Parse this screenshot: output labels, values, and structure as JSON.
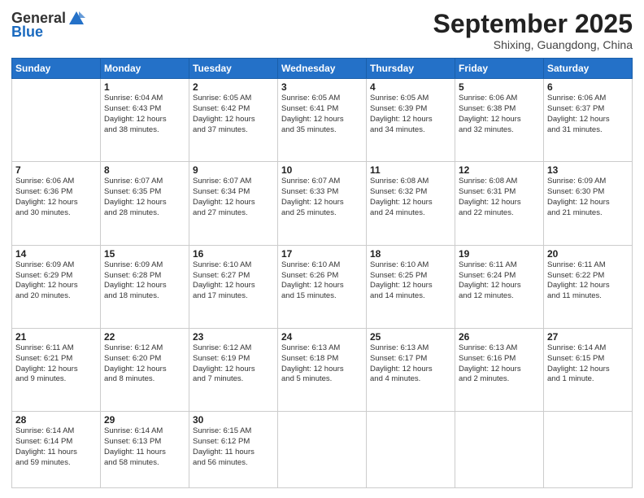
{
  "header": {
    "logo": {
      "general": "General",
      "blue": "Blue"
    },
    "title": "September 2025",
    "location": "Shixing, Guangdong, China"
  },
  "weekdays": [
    "Sunday",
    "Monday",
    "Tuesday",
    "Wednesday",
    "Thursday",
    "Friday",
    "Saturday"
  ],
  "weeks": [
    [
      {
        "day": "",
        "info": ""
      },
      {
        "day": "1",
        "info": "Sunrise: 6:04 AM\nSunset: 6:43 PM\nDaylight: 12 hours\nand 38 minutes."
      },
      {
        "day": "2",
        "info": "Sunrise: 6:05 AM\nSunset: 6:42 PM\nDaylight: 12 hours\nand 37 minutes."
      },
      {
        "day": "3",
        "info": "Sunrise: 6:05 AM\nSunset: 6:41 PM\nDaylight: 12 hours\nand 35 minutes."
      },
      {
        "day": "4",
        "info": "Sunrise: 6:05 AM\nSunset: 6:39 PM\nDaylight: 12 hours\nand 34 minutes."
      },
      {
        "day": "5",
        "info": "Sunrise: 6:06 AM\nSunset: 6:38 PM\nDaylight: 12 hours\nand 32 minutes."
      },
      {
        "day": "6",
        "info": "Sunrise: 6:06 AM\nSunset: 6:37 PM\nDaylight: 12 hours\nand 31 minutes."
      }
    ],
    [
      {
        "day": "7",
        "info": "Sunrise: 6:06 AM\nSunset: 6:36 PM\nDaylight: 12 hours\nand 30 minutes."
      },
      {
        "day": "8",
        "info": "Sunrise: 6:07 AM\nSunset: 6:35 PM\nDaylight: 12 hours\nand 28 minutes."
      },
      {
        "day": "9",
        "info": "Sunrise: 6:07 AM\nSunset: 6:34 PM\nDaylight: 12 hours\nand 27 minutes."
      },
      {
        "day": "10",
        "info": "Sunrise: 6:07 AM\nSunset: 6:33 PM\nDaylight: 12 hours\nand 25 minutes."
      },
      {
        "day": "11",
        "info": "Sunrise: 6:08 AM\nSunset: 6:32 PM\nDaylight: 12 hours\nand 24 minutes."
      },
      {
        "day": "12",
        "info": "Sunrise: 6:08 AM\nSunset: 6:31 PM\nDaylight: 12 hours\nand 22 minutes."
      },
      {
        "day": "13",
        "info": "Sunrise: 6:09 AM\nSunset: 6:30 PM\nDaylight: 12 hours\nand 21 minutes."
      }
    ],
    [
      {
        "day": "14",
        "info": "Sunrise: 6:09 AM\nSunset: 6:29 PM\nDaylight: 12 hours\nand 20 minutes."
      },
      {
        "day": "15",
        "info": "Sunrise: 6:09 AM\nSunset: 6:28 PM\nDaylight: 12 hours\nand 18 minutes."
      },
      {
        "day": "16",
        "info": "Sunrise: 6:10 AM\nSunset: 6:27 PM\nDaylight: 12 hours\nand 17 minutes."
      },
      {
        "day": "17",
        "info": "Sunrise: 6:10 AM\nSunset: 6:26 PM\nDaylight: 12 hours\nand 15 minutes."
      },
      {
        "day": "18",
        "info": "Sunrise: 6:10 AM\nSunset: 6:25 PM\nDaylight: 12 hours\nand 14 minutes."
      },
      {
        "day": "19",
        "info": "Sunrise: 6:11 AM\nSunset: 6:24 PM\nDaylight: 12 hours\nand 12 minutes."
      },
      {
        "day": "20",
        "info": "Sunrise: 6:11 AM\nSunset: 6:22 PM\nDaylight: 12 hours\nand 11 minutes."
      }
    ],
    [
      {
        "day": "21",
        "info": "Sunrise: 6:11 AM\nSunset: 6:21 PM\nDaylight: 12 hours\nand 9 minutes."
      },
      {
        "day": "22",
        "info": "Sunrise: 6:12 AM\nSunset: 6:20 PM\nDaylight: 12 hours\nand 8 minutes."
      },
      {
        "day": "23",
        "info": "Sunrise: 6:12 AM\nSunset: 6:19 PM\nDaylight: 12 hours\nand 7 minutes."
      },
      {
        "day": "24",
        "info": "Sunrise: 6:13 AM\nSunset: 6:18 PM\nDaylight: 12 hours\nand 5 minutes."
      },
      {
        "day": "25",
        "info": "Sunrise: 6:13 AM\nSunset: 6:17 PM\nDaylight: 12 hours\nand 4 minutes."
      },
      {
        "day": "26",
        "info": "Sunrise: 6:13 AM\nSunset: 6:16 PM\nDaylight: 12 hours\nand 2 minutes."
      },
      {
        "day": "27",
        "info": "Sunrise: 6:14 AM\nSunset: 6:15 PM\nDaylight: 12 hours\nand 1 minute."
      }
    ],
    [
      {
        "day": "28",
        "info": "Sunrise: 6:14 AM\nSunset: 6:14 PM\nDaylight: 11 hours\nand 59 minutes."
      },
      {
        "day": "29",
        "info": "Sunrise: 6:14 AM\nSunset: 6:13 PM\nDaylight: 11 hours\nand 58 minutes."
      },
      {
        "day": "30",
        "info": "Sunrise: 6:15 AM\nSunset: 6:12 PM\nDaylight: 11 hours\nand 56 minutes."
      },
      {
        "day": "",
        "info": ""
      },
      {
        "day": "",
        "info": ""
      },
      {
        "day": "",
        "info": ""
      },
      {
        "day": "",
        "info": ""
      }
    ]
  ]
}
